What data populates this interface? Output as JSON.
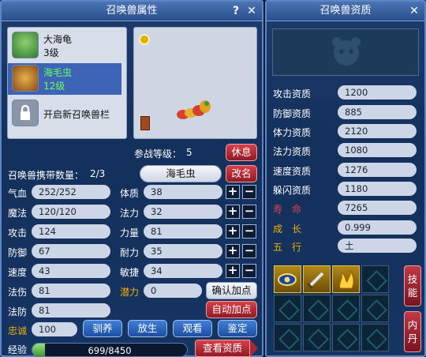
{
  "left_window": {
    "title": "召唤兽属性",
    "help_label": "?",
    "close_label": "✕",
    "pets": [
      {
        "name": "大海龟",
        "level": "3级",
        "selected": false
      },
      {
        "name": "海毛虫",
        "level": "12级",
        "selected": true
      }
    ],
    "unlock_label": "开启新召唤兽栏",
    "battle_level_label": "参战等级：",
    "battle_level_value": "5",
    "rest_button": "休息",
    "carry_label": "召唤兽携带数量：",
    "carry_value": "2/3",
    "pet_name": "海毛虫",
    "rename_button": "改名",
    "stats": {
      "hp_label": "气血",
      "hp_value": "252/252",
      "mp_label": "魔法",
      "mp_value": "120/120",
      "atk_label": "攻击",
      "atk_value": "124",
      "def_label": "防御",
      "def_value": "67",
      "spd_label": "速度",
      "spd_value": "43",
      "mdmg_label": "法伤",
      "mdmg_value": "81",
      "mdef_label": "法防",
      "mdef_value": "81",
      "con_label": "体质",
      "con_value": "38",
      "mag_label": "法力",
      "mag_value": "32",
      "str_label": "力量",
      "str_value": "81",
      "end_label": "耐力",
      "end_value": "35",
      "agi_label": "敏捷",
      "agi_value": "34",
      "pot_label": "潜力",
      "pot_value": "0"
    },
    "plus_label": "+",
    "minus_label": "−",
    "confirm_points_button": "确认加点",
    "auto_points_button": "自动加点",
    "loyalty_label": "忠诚",
    "loyalty_value": "100",
    "tame_button": "驯养",
    "release_button": "放生",
    "watch_button": "观看",
    "appraise_button": "鉴定",
    "exp_label": "经验",
    "exp_value": "699/8450",
    "exp_progress": 0.083,
    "view_aptitude_button": "查看资质"
  },
  "right_window": {
    "title": "召唤兽资质",
    "close_label": "✕",
    "aptitudes": [
      {
        "label": "攻击资质",
        "value": "1200"
      },
      {
        "label": "防御资质",
        "value": "885"
      },
      {
        "label": "体力资质",
        "value": "2120"
      },
      {
        "label": "法力资质",
        "value": "1080"
      },
      {
        "label": "速度资质",
        "value": "1276"
      },
      {
        "label": "躲闪资质",
        "value": "1180"
      }
    ],
    "lifespan_label": "寿　命",
    "lifespan_value": "7265",
    "growth_label": "成　长",
    "growth_value": "0.999",
    "element_label": "五　行",
    "element_value": "土",
    "skills_button": "技能",
    "inner_dan_button": "内丹"
  },
  "colors": {
    "gold": "#f0b000",
    "red_button": "#c23846",
    "blue_button": "#2a62c0"
  }
}
